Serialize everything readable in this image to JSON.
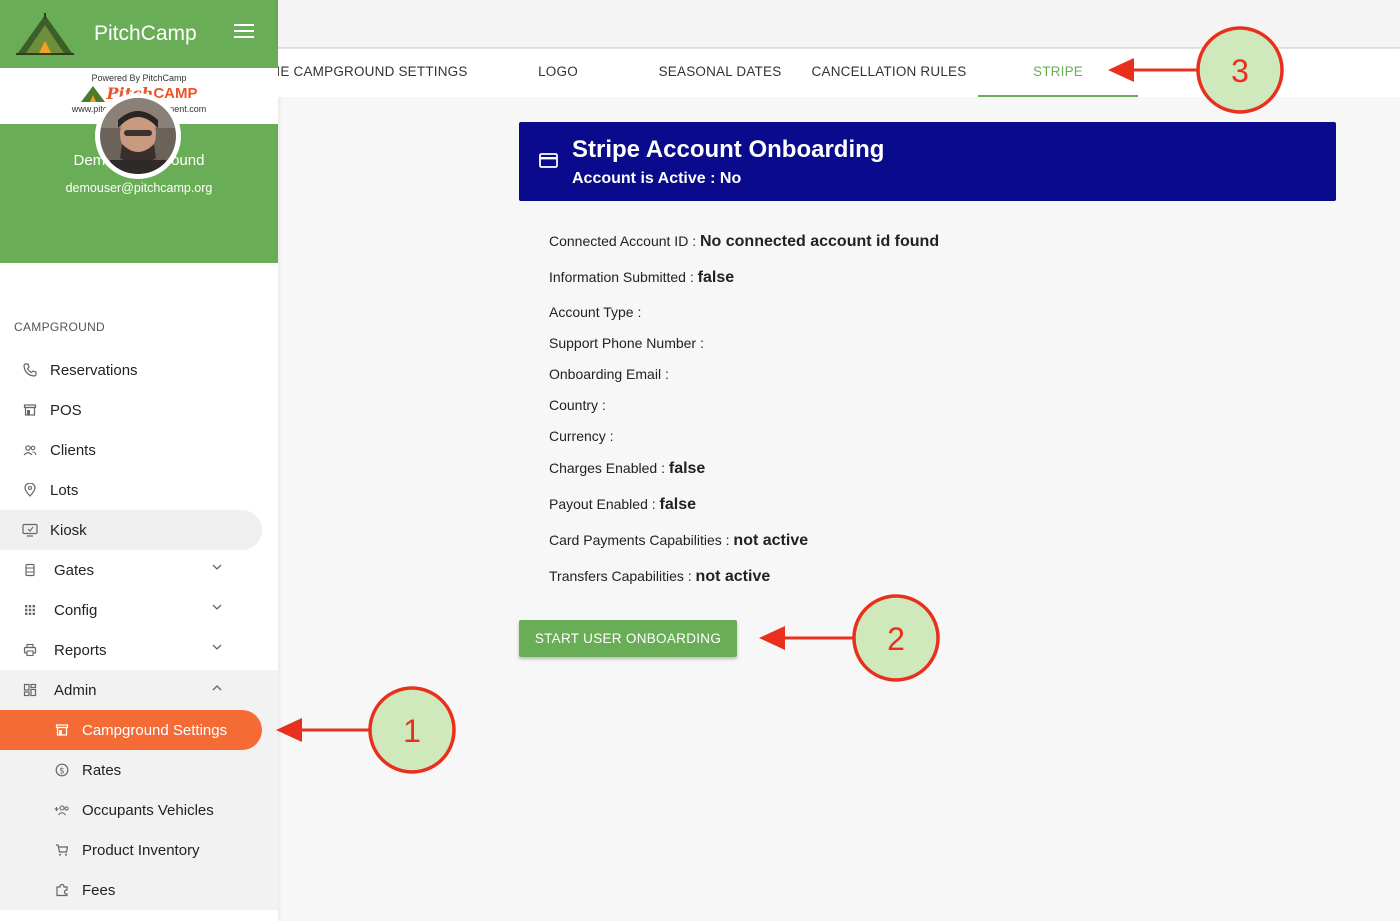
{
  "app": {
    "title": "PitchCamp",
    "powered_by": "Powered By PitchCamp",
    "brand_pitch": "Pitch",
    "brand_camp": "CAMP",
    "brand_url": "www.pitchcampmanagement.com"
  },
  "profile": {
    "campground_name": "Demo Campground",
    "email": "demouser@pitchcamp.org"
  },
  "sidebar": {
    "section_label": "CAMPGROUND",
    "items": [
      {
        "label": "Reservations",
        "icon": "phone-icon"
      },
      {
        "label": "POS",
        "icon": "store-icon"
      },
      {
        "label": "Clients",
        "icon": "people-icon"
      },
      {
        "label": "Lots",
        "icon": "location-pin-icon"
      },
      {
        "label": "Kiosk",
        "icon": "kiosk-icon"
      },
      {
        "label": "Gates",
        "icon": "gate-icon"
      },
      {
        "label": "Config",
        "icon": "grid-icon"
      },
      {
        "label": "Reports",
        "icon": "printer-icon"
      },
      {
        "label": "Admin",
        "icon": "dashboard-icon"
      }
    ],
    "admin_sub_items": [
      {
        "label": "Campground Settings",
        "icon": "store-icon"
      },
      {
        "label": "Rates",
        "icon": "dollar-icon"
      },
      {
        "label": "Occupants Vehicles",
        "icon": "add-group-icon"
      },
      {
        "label": "Product Inventory",
        "icon": "cart-icon"
      },
      {
        "label": "Fees",
        "icon": "puzzle-icon"
      }
    ]
  },
  "tabs": [
    {
      "label": "IE CAMPGROUND SETTINGS"
    },
    {
      "label": "LOGO"
    },
    {
      "label": "SEASONAL DATES"
    },
    {
      "label": "CANCELLATION RULES"
    },
    {
      "label": "STRIPE"
    }
  ],
  "stripe": {
    "title": "Stripe Account Onboarding",
    "status": "Account is Active : No",
    "fields": [
      {
        "label": "Connected Account ID : ",
        "value": "No connected account id found"
      },
      {
        "label": "Information Submitted : ",
        "value": "false"
      },
      {
        "label": "Account Type : ",
        "value": ""
      },
      {
        "label": "Support Phone Number : ",
        "value": ""
      },
      {
        "label": "Onboarding Email : ",
        "value": ""
      },
      {
        "label": "Country : ",
        "value": ""
      },
      {
        "label": "Currency : ",
        "value": ""
      },
      {
        "label": "Charges Enabled : ",
        "value": "false"
      },
      {
        "label": "Payout Enabled : ",
        "value": "false"
      },
      {
        "label": "Card Payments Capabilities : ",
        "value": "not active"
      },
      {
        "label": "Transfers Capabilities : ",
        "value": "not active"
      }
    ],
    "button_label": "START USER ONBOARDING"
  },
  "annotations": {
    "one": "1",
    "two": "2",
    "three": "3"
  },
  "colors": {
    "brand_green": "#6aad57",
    "active_orange": "#f46b35",
    "banner_navy": "#0a0a8c",
    "annotation_red": "#e8301c",
    "annotation_fill": "#cfe9bd"
  }
}
